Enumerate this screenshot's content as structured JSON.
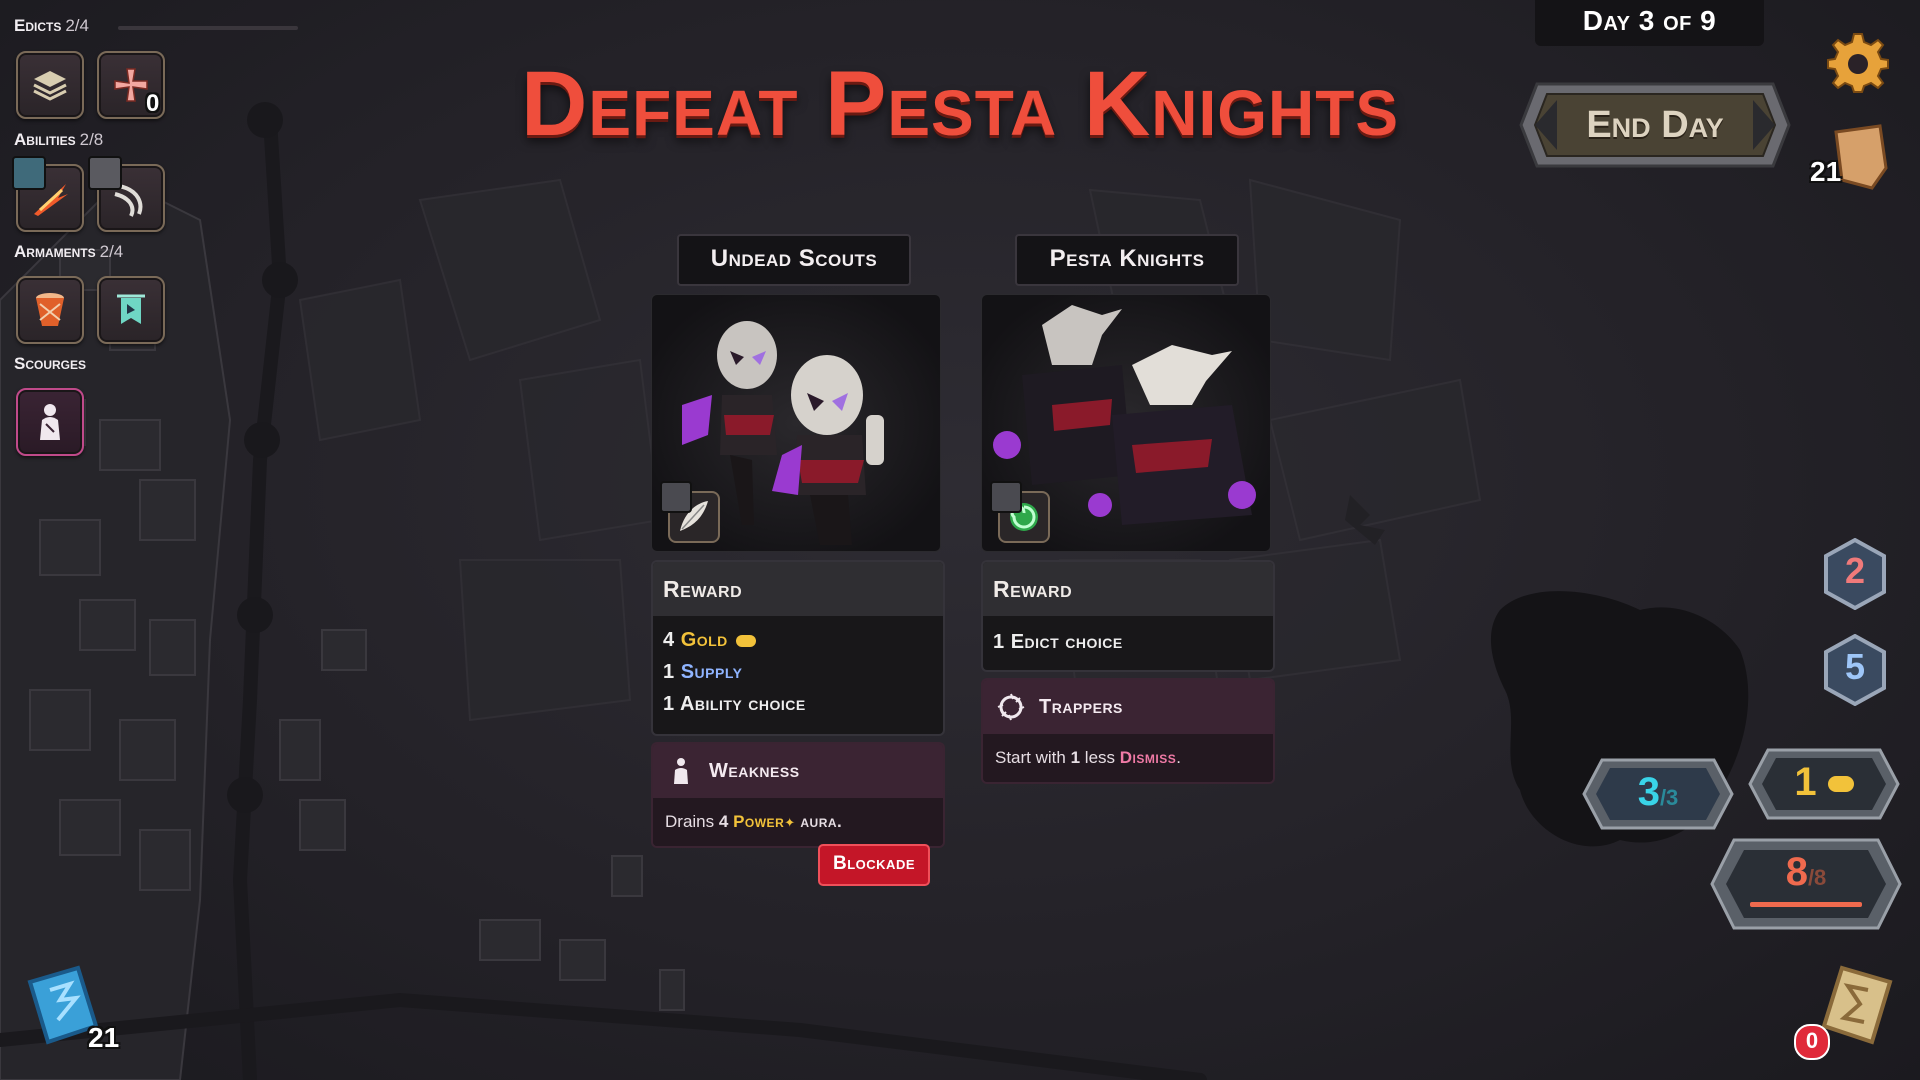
{
  "left_panel": {
    "edicts": {
      "label": "Edicts",
      "count": "2/4",
      "badge": "0"
    },
    "abilities": {
      "label": "Abilities",
      "count": "2/8"
    },
    "armaments": {
      "label": "Armaments",
      "count": "2/4"
    },
    "scourges": {
      "label": "Scourges"
    }
  },
  "title": "Defeat Pesta Knights",
  "day": {
    "text": "Day 3 of 9"
  },
  "end_day_label": "End Day",
  "deck_count_top": "21",
  "enemies": [
    {
      "name": "Undead Scouts",
      "reward_header": "Reward",
      "rewards": [
        {
          "num": "4",
          "text": "Gold"
        },
        {
          "num": "1",
          "text": "Supply"
        },
        {
          "num": "1",
          "text": "Ability choice"
        }
      ],
      "trait_name": "Weakness",
      "trait_pre": "Drains ",
      "trait_num": "4",
      "trait_kw": "Power",
      "trait_post": " aura."
    },
    {
      "name": "Pesta Knights",
      "reward_header": "Reward",
      "rewards": [
        {
          "num": "1",
          "text": "Edict choice"
        }
      ],
      "trait_name": "Trappers",
      "trait_pre": "Start with ",
      "trait_num": "1",
      "trait_mid": " less ",
      "trait_kw": "Dismiss",
      "trait_post": "."
    }
  ],
  "blockade_label": "Blockade",
  "hud": {
    "hex_top": "2",
    "hex_mid": "5",
    "actions": {
      "value": "3",
      "max": "/3"
    },
    "gold": "1",
    "power": {
      "value": "8",
      "max": "/8",
      "fill": 1.0
    }
  },
  "draw_pile_count": "21",
  "discard_count": "0",
  "colors": {
    "title": "#ef4e3c",
    "gold": "#f2c23a",
    "actions": "#39d4e8",
    "power": "#ef6a4e"
  }
}
